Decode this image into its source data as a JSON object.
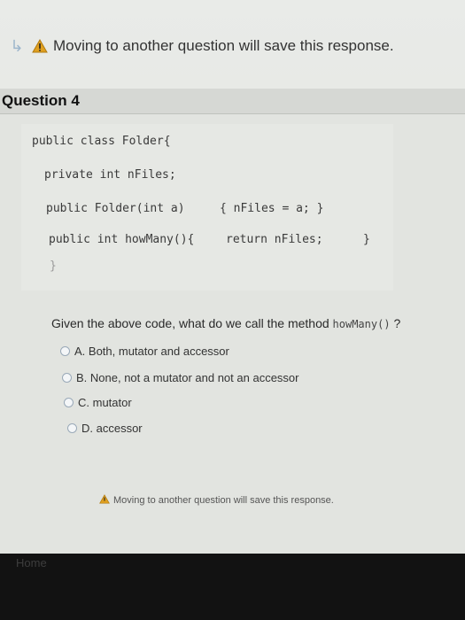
{
  "notice": {
    "top_text": "Moving to another question will save this response.",
    "bottom_text": "Moving to another question will save this response."
  },
  "question": {
    "title": "Question 4",
    "code": {
      "line1": "public class Folder{",
      "line2": "private int nFiles;",
      "line3a": "public Folder(int a)",
      "line3b": "{ nFiles = a; }",
      "line4a": "public int howMany(){",
      "line4b": "return nFiles;",
      "line4c": "}",
      "line5": "}"
    },
    "prompt_pre": "Given the above code, what do we call the method ",
    "prompt_code": "howMany()",
    "prompt_post": " ?",
    "options": [
      {
        "label": "A. Both, mutator and accessor"
      },
      {
        "label": "B. None, not a mutator and not an accessor"
      },
      {
        "label": "C. mutator"
      },
      {
        "label": "D. accessor"
      }
    ]
  },
  "colors": {
    "warning": "#e0a020",
    "radio_border": "#9aa9b8"
  },
  "icons": {
    "arrow": "return-arrow-icon",
    "warning": "warning-triangle-icon"
  },
  "footer": {
    "partial_text": "Home"
  }
}
